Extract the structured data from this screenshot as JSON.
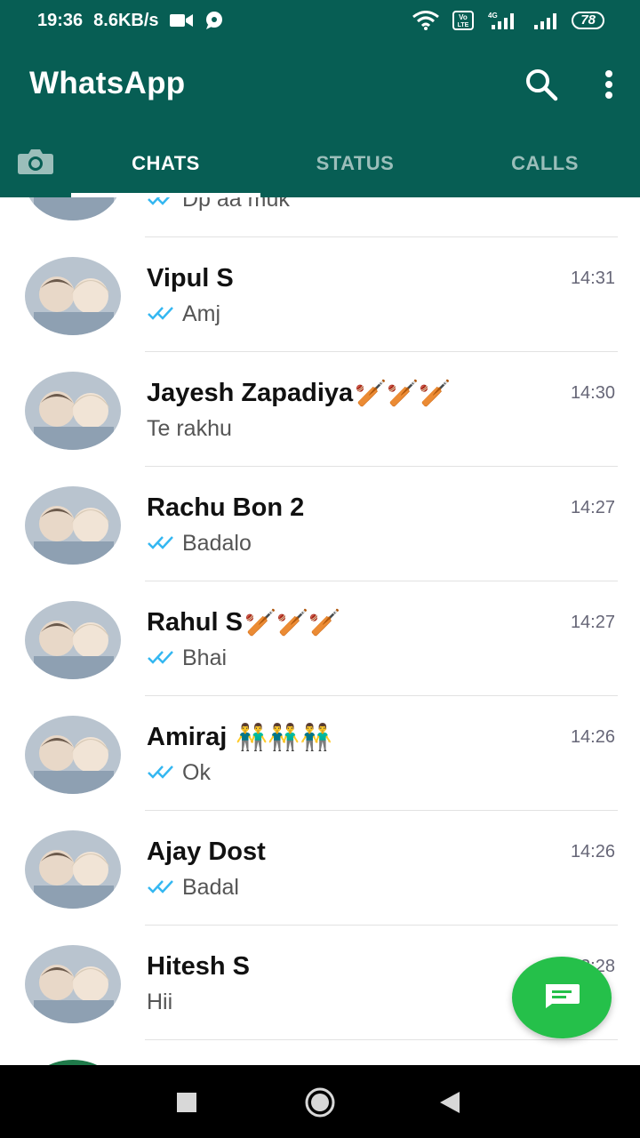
{
  "status_bar": {
    "time": "19:36",
    "speed": "8.6KB/s",
    "network_label": "4G",
    "volte_label": "Vo LTE",
    "battery": "78"
  },
  "app": {
    "title": "WhatsApp"
  },
  "tabs": [
    {
      "label": "CHATS",
      "active": true
    },
    {
      "label": "STATUS",
      "active": false
    },
    {
      "label": "CALLS",
      "active": false
    }
  ],
  "chats": [
    {
      "name": "",
      "preview": "Dp aa muk",
      "time": "",
      "read": true
    },
    {
      "name": "Vipul S",
      "preview": "Amj",
      "time": "14:31",
      "read": true
    },
    {
      "name": "Jayesh Zapadiya",
      "emoji": "🏏🏏🏏",
      "preview": "Te rakhu",
      "time": "14:30",
      "read": false
    },
    {
      "name": "Rachu Bon 2",
      "preview": "Badalo",
      "time": "14:27",
      "read": true
    },
    {
      "name": "Rahul S",
      "emoji": "🏏🏏🏏",
      "preview": "Bhai",
      "time": "14:27",
      "read": true
    },
    {
      "name": "Amiraj",
      "emoji": "👬👬👬",
      "preview": "Ok",
      "time": "14:26",
      "read": true
    },
    {
      "name": "Ajay Dost",
      "preview": "Badal",
      "time": "14:26",
      "read": true
    },
    {
      "name": "Hitesh S",
      "preview": "Hii",
      "time": "13:28",
      "read": false
    }
  ],
  "colors": {
    "header": "#075e54",
    "fab": "#25c04a",
    "tick": "#34b7f1"
  }
}
